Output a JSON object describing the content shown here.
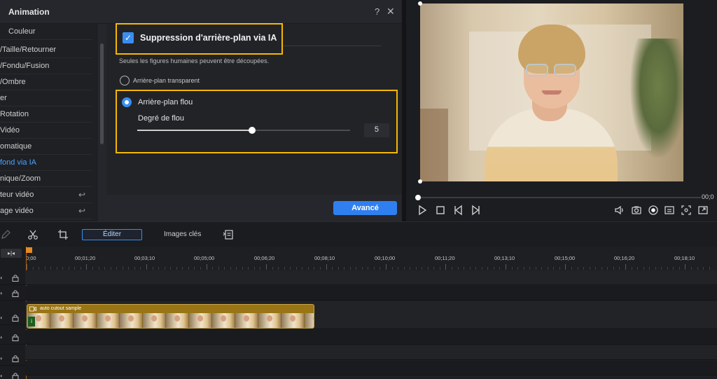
{
  "animation_panel": {
    "title": "Animation",
    "help_glyph": "?",
    "close_glyph": "✕",
    "menu_items": [
      {
        "label": "Couleur"
      },
      {
        "label": "/Taille/Retourner"
      },
      {
        "label": "/Fondu/Fusion"
      },
      {
        "label": "/Ombre"
      },
      {
        "label": "er"
      },
      {
        "label": "Rotation"
      },
      {
        "label": "Vidéo"
      },
      {
        "label": "omatique"
      },
      {
        "label": "fond via IA",
        "active": true
      },
      {
        "label": "nique/Zoom"
      },
      {
        "label": "teur vidéo",
        "back_icon": "↩"
      },
      {
        "label": "age vidéo",
        "back_icon": "↩"
      }
    ],
    "ai_removal": {
      "checked": true,
      "check_glyph": "✓",
      "label": "Suppression d'arrière-plan via IA",
      "note": "Seules les figures humaines peuvent être découpées."
    },
    "options": {
      "transparent_label": "Arrière-plan transparent",
      "blur_label": "Arrière-plan flou",
      "selected": "blur"
    },
    "blur_degree": {
      "label": "Degré de flou",
      "value": "5",
      "slider_fraction": 0.54
    },
    "advanced_button": "Avancé",
    "highlight_color": "#f5b800",
    "accent_color": "#3a8ef0"
  },
  "preview": {
    "time_readout": "00;0",
    "progress_fraction": 0.0,
    "controls_left": [
      "play-icon",
      "stop-icon",
      "prev-frame-icon",
      "next-frame-icon"
    ],
    "controls_right": [
      "volume-icon",
      "snapshot-icon",
      "record-icon",
      "subtitle-icon",
      "crop-icon",
      "fullscreen-icon"
    ]
  },
  "timeline_toolbar": {
    "edit_label": "Éditer",
    "keyframes_label": "Images clés",
    "icons": [
      "pen-icon",
      "scissors-icon",
      "crop-icon",
      "keyframe-list-icon"
    ]
  },
  "timeline": {
    "fit_button": "▸|◂",
    "ruler_labels": [
      "0;00",
      "00;01;20",
      "00;03;10",
      "00;05;00",
      "00;06;20",
      "00;08;10",
      "00;10;00",
      "00;11;20",
      "00;13;10",
      "00;15;00",
      "00;16;20",
      "00;18;10"
    ],
    "clip": {
      "name": "auto cutout sample",
      "badge": "i"
    },
    "playhead_color": "#e68a1f"
  }
}
